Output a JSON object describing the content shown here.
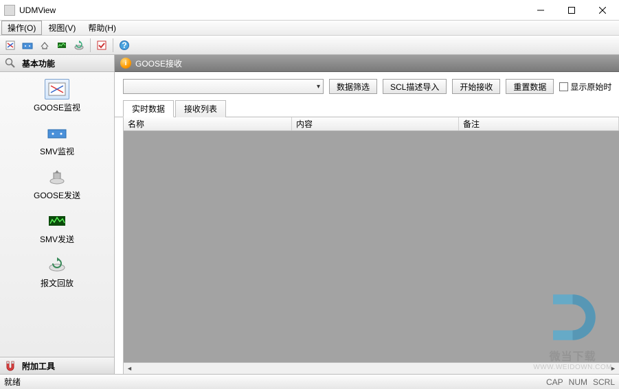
{
  "window": {
    "title": "UDMView"
  },
  "menubar": {
    "items": [
      {
        "label": "操作(O)"
      },
      {
        "label": "视图(V)"
      },
      {
        "label": "帮助(H)"
      }
    ]
  },
  "sidebar": {
    "header_label": "基本功能",
    "items": [
      {
        "label": "GOOSE监视"
      },
      {
        "label": "SMV监视"
      },
      {
        "label": "GOOSE发送"
      },
      {
        "label": "SMV发送"
      },
      {
        "label": "报文回放"
      }
    ],
    "footer_label": "附加工具"
  },
  "content": {
    "header_title": "GOOSE接收",
    "info_glyph": "i",
    "buttons": {
      "filter": "数据筛选",
      "import": "SCL描述导入",
      "start": "开始接收",
      "reset": "重置数据"
    },
    "checkbox_label": "显示原始时",
    "tabs": [
      {
        "label": "实时数据"
      },
      {
        "label": "接收列表"
      }
    ],
    "columns": {
      "name": "名称",
      "content": "内容",
      "remark": "备注"
    }
  },
  "statusbar": {
    "ready": "就绪",
    "cap": "CAP",
    "num": "NUM",
    "scrl": "SCRL"
  },
  "watermark": {
    "text": "微当下载",
    "url": "WWW.WEIDOWN.COM"
  }
}
